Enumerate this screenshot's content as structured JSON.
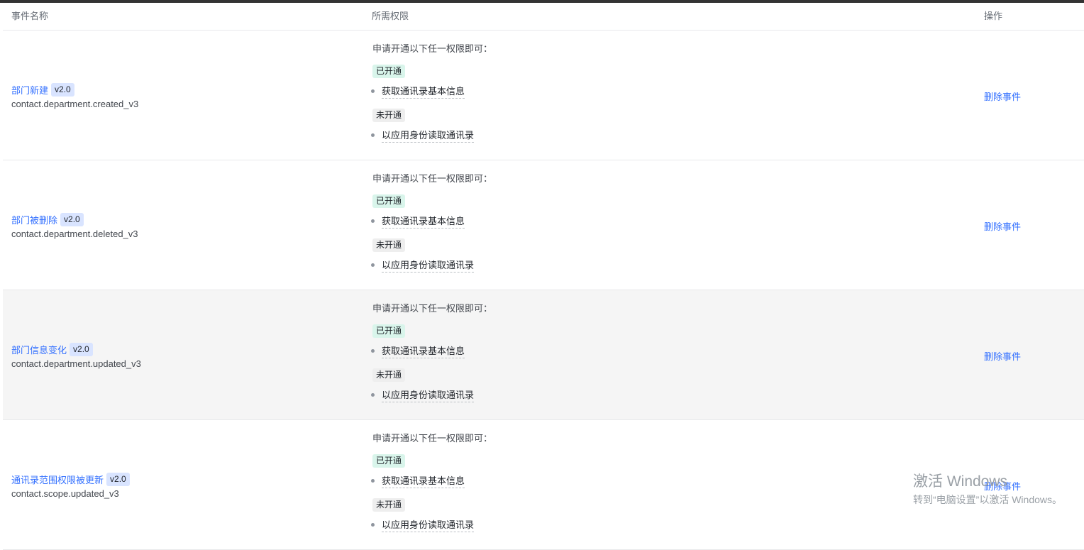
{
  "header": {
    "col_name": "事件名称",
    "col_permission": "所需权限",
    "col_action": "操作"
  },
  "rows": [
    {
      "name": "部门新建",
      "version": "v2.0",
      "key": "contact.department.created_v3",
      "perm_title": "申请开通以下任一权限即可：",
      "enabled_label": "已开通",
      "enabled_perm": "获取通讯录基本信息",
      "disabled_label": "未开通",
      "disabled_perm": "以应用身份读取通讯录",
      "action": "删除事件"
    },
    {
      "name": "部门被删除",
      "version": "v2.0",
      "key": "contact.department.deleted_v3",
      "perm_title": "申请开通以下任一权限即可：",
      "enabled_label": "已开通",
      "enabled_perm": "获取通讯录基本信息",
      "disabled_label": "未开通",
      "disabled_perm": "以应用身份读取通讯录",
      "action": "删除事件"
    },
    {
      "name": "部门信息变化",
      "version": "v2.0",
      "key": "contact.department.updated_v3",
      "perm_title": "申请开通以下任一权限即可：",
      "enabled_label": "已开通",
      "enabled_perm": "获取通讯录基本信息",
      "disabled_label": "未开通",
      "disabled_perm": "以应用身份读取通讯录",
      "action": "删除事件"
    },
    {
      "name": "通讯录范围权限被更新",
      "version": "v2.0",
      "key": "contact.scope.updated_v3",
      "perm_title": "申请开通以下任一权限即可：",
      "enabled_label": "已开通",
      "enabled_perm": "获取通讯录基本信息",
      "disabled_label": "未开通",
      "disabled_perm": "以应用身份读取通讯录",
      "action": "删除事件"
    }
  ],
  "watermark": {
    "line1": "激活 Windows",
    "line2": "转到“电脑设置”以激活 Windows。"
  },
  "colors": {
    "link": "#3370ff",
    "enabled_tag_bg": "#d9f5eb",
    "disabled_tag_bg": "#eeeeee",
    "version_badge_bg": "#d9e4ff",
    "hover_row_bg": "#f5f5f5"
  }
}
